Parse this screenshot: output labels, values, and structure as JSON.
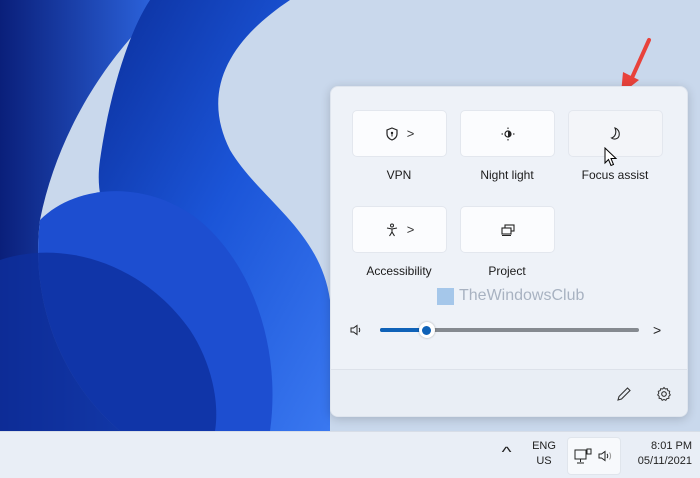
{
  "quick_settings": {
    "tiles": [
      {
        "label": "VPN",
        "icon": "shield-icon",
        "has_chevron": true
      },
      {
        "label": "Night light",
        "icon": "brightness-icon",
        "has_chevron": false
      },
      {
        "label": "Focus assist",
        "icon": "moon-icon",
        "has_chevron": false
      },
      {
        "label": "Accessibility",
        "icon": "accessibility-icon",
        "has_chevron": true
      },
      {
        "label": "Project",
        "icon": "project-icon",
        "has_chevron": false
      }
    ],
    "chevron": ">",
    "volume_percent": 18,
    "watermark": "TheWindowsClub",
    "accent": "#0f62b8"
  },
  "taskbar": {
    "lang_top": "ENG",
    "lang_bottom": "US",
    "time": "8:01 PM",
    "date": "05/11/2021",
    "overflow_chevron": "^"
  }
}
